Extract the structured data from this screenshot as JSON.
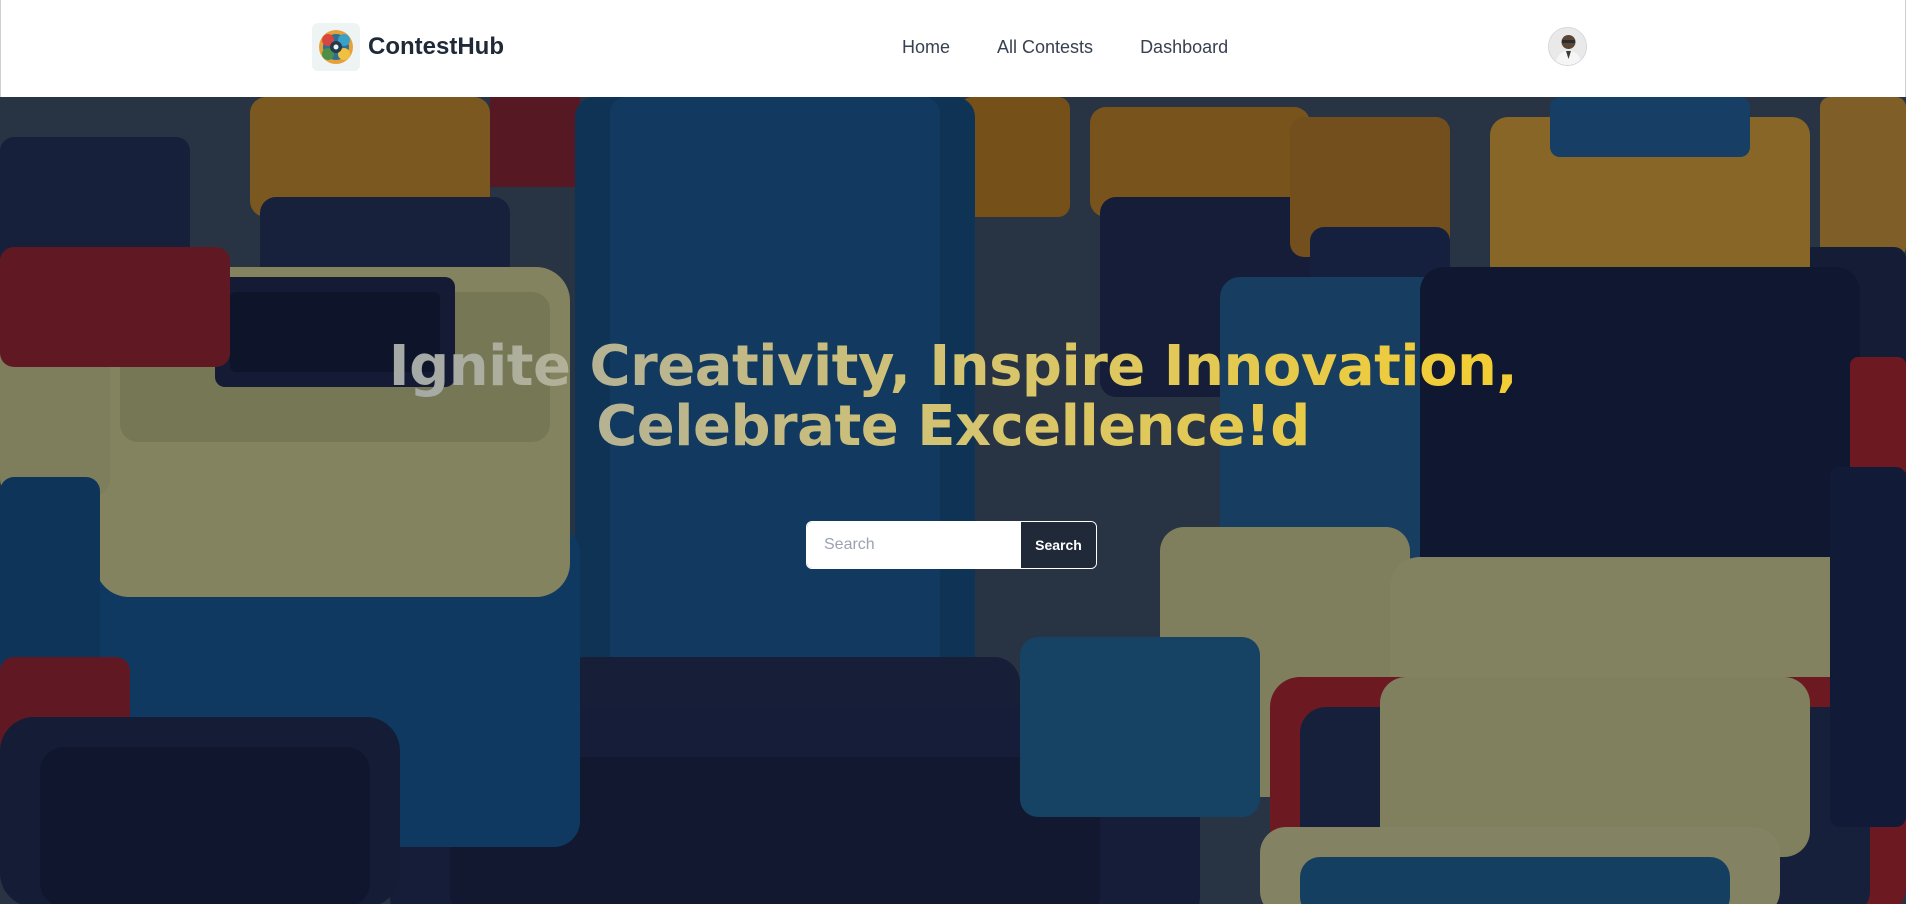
{
  "brand": {
    "name": "ContestHub",
    "logo_icon": "gear-cluster-logo-icon"
  },
  "nav": {
    "items": [
      {
        "label": "Home"
      },
      {
        "label": "All Contests"
      },
      {
        "label": "Dashboard"
      }
    ]
  },
  "user": {
    "avatar_icon": "user-avatar"
  },
  "hero": {
    "headline_line1": "Ignite Creativity, Inspire Innovation,",
    "headline_line2": "Celebrate Excellence!d",
    "search": {
      "placeholder": "Search",
      "value": "",
      "button_label": "Search"
    },
    "colors": {
      "gradient_start": "#a6aaa6",
      "gradient_mid": "#d7c56d",
      "gradient_end": "#f2cd34",
      "button_bg": "#1f2937"
    }
  }
}
